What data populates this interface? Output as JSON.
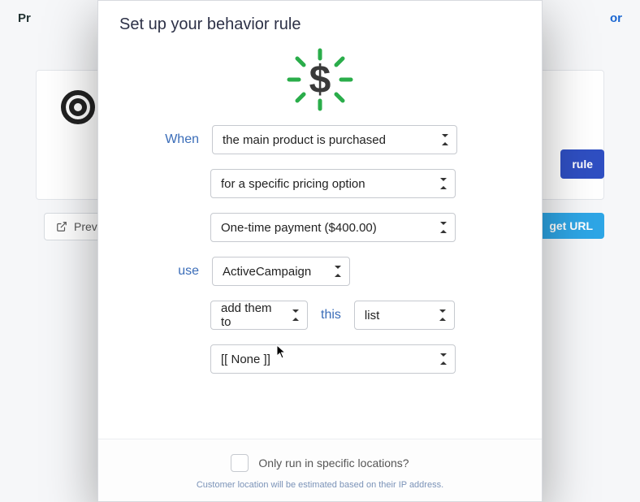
{
  "background": {
    "left_crumb": "Pr",
    "right_link": "or",
    "rule_btn": "rule",
    "preview_btn": "Previe",
    "url_btn": "get URL"
  },
  "modal": {
    "title": "Set up your behavior rule",
    "labels": {
      "when": "When",
      "use": "use",
      "this": "this"
    },
    "selects": {
      "trigger": "the main product is purchased",
      "condition": "for a specific pricing option",
      "pricing": "One-time payment ($400.00)",
      "integration": "ActiveCampaign",
      "action": "add them to",
      "object_type": "list",
      "target": "[[ None ]]"
    },
    "location": {
      "checkbox_label": "Only run in specific locations?",
      "hint": "Customer location will be estimated based on their IP address."
    }
  }
}
